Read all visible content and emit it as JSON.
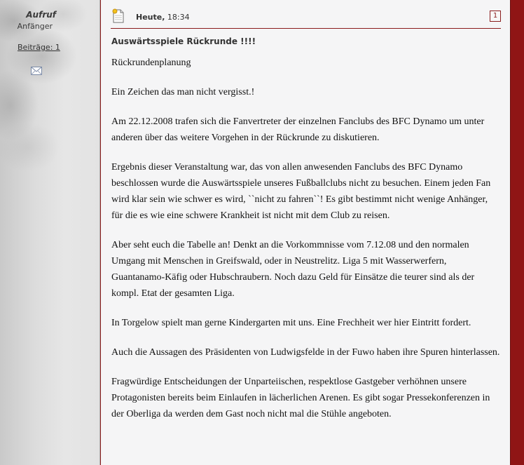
{
  "user": {
    "name": "Aufruf",
    "rank": "Anfänger",
    "posts": "Beiträge: 1"
  },
  "post": {
    "date_label": "Heute,",
    "time": "18:34",
    "number": "1",
    "title": "Auswärtsspiele Rückrunde !!!!",
    "paragraphs": [
      "Rückrundenplanung",
      "Ein Zeichen das man nicht vergisst.!",
      "Am 22.12.2008 trafen sich die Fanvertreter der einzelnen Fanclubs des BFC Dynamo um unter anderen über das weitere Vorgehen in der Rückrunde zu diskutieren.",
      "Ergebnis dieser Veranstaltung war, das von allen anwesenden Fanclubs des BFC Dynamo beschlossen wurde die Auswärtsspiele unseres Fußballclubs nicht zu besuchen. Einem jeden Fan wird klar sein wie schwer es wird, ``nicht zu fahren``! Es gibt bestimmt nicht wenige Anhänger, für die es wie eine schwere Krankheit ist nicht mit dem Club zu reisen.",
      "Aber seht euch die Tabelle an! Denkt an die Vorkommnisse vom 7.12.08 und den normalen Umgang mit Menschen in Greifswald, oder in Neustrelitz. Liga 5 mit Wasserwerfern, Guantanamo-Käfig oder Hubschraubern. Noch dazu Geld für Einsätze die teurer sind als der kompl. Etat der gesamten Liga.",
      "In Torgelow spielt man gerne Kindergarten mit uns. Eine Frechheit wer hier Eintritt fordert.",
      "Auch die Aussagen des Präsidenten von Ludwigsfelde in der Fuwo haben ihre Spuren hinterlassen.",
      "Fragwürdige Entscheidungen der Unparteiischen, respektlose Gastgeber verhöhnen unsere Protagonisten bereits beim Einlaufen in lächerlichen Arenen. Es gibt sogar Pressekonferenzen in der Oberliga da werden dem Gast noch nicht mal die Stühle angeboten."
    ]
  },
  "icons": {
    "pm": "envelope-icon",
    "post": "document-icon"
  },
  "colors": {
    "accent": "#8a1c1c",
    "right_bar": "#8f1515",
    "post_bg": "#f5f5f6"
  }
}
